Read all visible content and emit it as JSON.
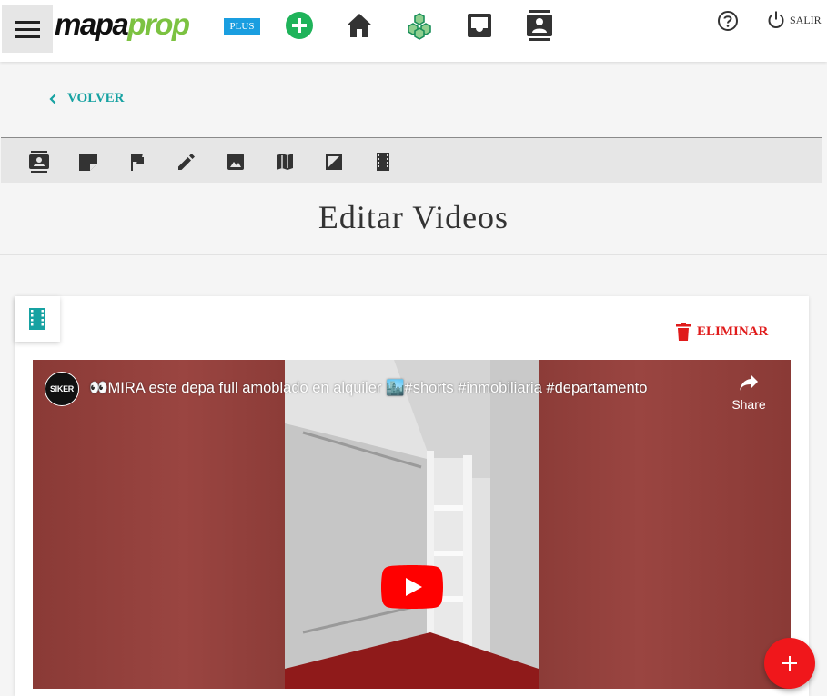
{
  "header": {
    "logo_dark": "mapa",
    "logo_green": "prop",
    "plus_label": "PLUS",
    "logout_label": "SALIR"
  },
  "nav": {
    "back_label": "VOLVER"
  },
  "page": {
    "title": "Editar Videos"
  },
  "card": {
    "delete_label": "ELIMINAR"
  },
  "video": {
    "channel_avatar_text": "SIKER",
    "title": "👀MIRA este depa full amoblado en alquiler 🏙️#shorts #inmobiliaria #departamento",
    "share_label": "Share"
  },
  "colors": {
    "accent_teal": "#17a2a2",
    "accent_green": "#7cc241",
    "plus_blue": "#1a9ee0",
    "danger_red": "#e01b1b",
    "fab_red": "#f0171b"
  },
  "icons": {
    "menu": "hamburger-icon",
    "add": "plus-circle-icon",
    "home": "home-icon",
    "network": "hexagon-network-icon",
    "inbox": "inbox-icon",
    "contacts": "contact-card-icon",
    "help": "help-circle-icon",
    "power": "power-icon",
    "back": "chevron-left-icon",
    "delete": "trash-icon",
    "share": "share-arrow-icon",
    "play": "youtube-play-icon",
    "fab": "plus-icon"
  }
}
